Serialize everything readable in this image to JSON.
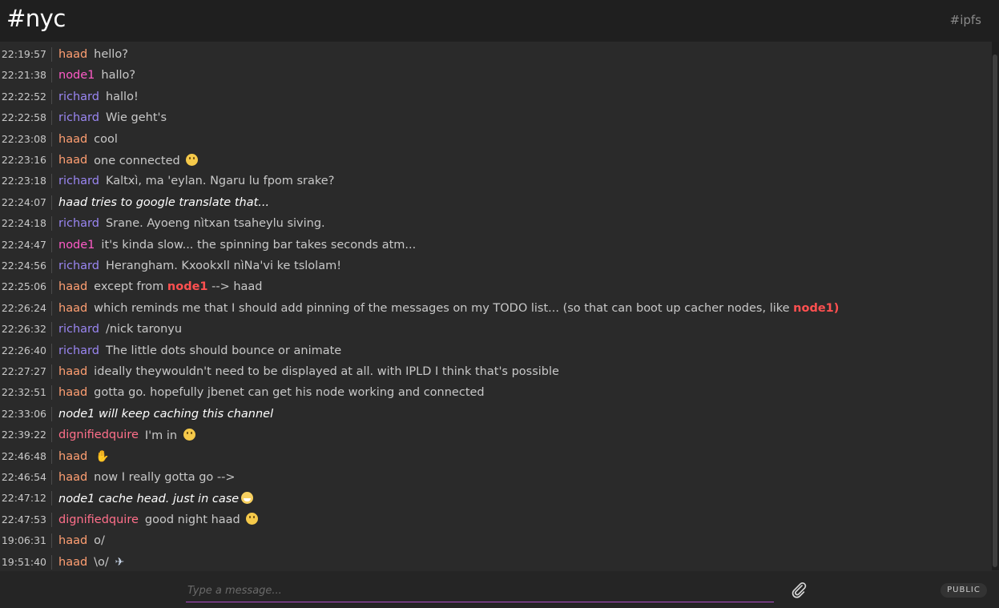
{
  "header": {
    "channel": "#nyc",
    "network_link": "#ipfs"
  },
  "messages": [
    {
      "time": "22:19:57",
      "nick": "haad",
      "type": "msg",
      "parts": [
        {
          "t": "hello?"
        }
      ]
    },
    {
      "time": "22:21:38",
      "nick": "node1",
      "type": "msg",
      "parts": [
        {
          "t": "hallo?"
        }
      ]
    },
    {
      "time": "22:22:52",
      "nick": "richard",
      "type": "msg",
      "parts": [
        {
          "t": "hallo!"
        }
      ]
    },
    {
      "time": "22:22:58",
      "nick": "richard",
      "type": "msg",
      "parts": [
        {
          "t": "Wie geht's"
        }
      ]
    },
    {
      "time": "22:23:08",
      "nick": "haad",
      "type": "msg",
      "parts": [
        {
          "t": "cool"
        }
      ]
    },
    {
      "time": "22:23:16",
      "nick": "haad",
      "type": "msg",
      "parts": [
        {
          "t": "one connected "
        }
      ],
      "emoji": "smile"
    },
    {
      "time": "22:23:18",
      "nick": "richard",
      "type": "msg",
      "parts": [
        {
          "t": "Kaltxì, ma 'eylan. Ngaru lu fpom srake?"
        }
      ]
    },
    {
      "time": "22:24:07",
      "nick": "haad",
      "type": "action",
      "parts": [
        {
          "t": "haad tries to google translate that..."
        }
      ]
    },
    {
      "time": "22:24:18",
      "nick": "richard",
      "type": "msg",
      "parts": [
        {
          "t": "Srane. Ayoeng nìtxan tsaheylu siving."
        }
      ]
    },
    {
      "time": "22:24:47",
      "nick": "node1",
      "type": "msg",
      "parts": [
        {
          "t": "it's kinda slow... the spinning bar takes seconds atm..."
        }
      ]
    },
    {
      "time": "22:24:56",
      "nick": "richard",
      "type": "msg",
      "parts": [
        {
          "t": "Herangham. Kxookxll nìNa'vi ke tslolam!"
        }
      ]
    },
    {
      "time": "22:25:06",
      "nick": "haad",
      "type": "msg",
      "parts": [
        {
          "t": "except from "
        },
        {
          "t": "node1",
          "m": true
        },
        {
          "t": " --> haad"
        }
      ]
    },
    {
      "time": "22:26:24",
      "nick": "haad",
      "type": "msg",
      "parts": [
        {
          "t": "which reminds me that I should add pinning of the messages on my TODO list... (so that can boot up cacher nodes, like "
        },
        {
          "t": "node1)",
          "m": true
        }
      ]
    },
    {
      "time": "22:26:32",
      "nick": "richard",
      "type": "msg",
      "parts": [
        {
          "t": "/nick taronyu"
        }
      ]
    },
    {
      "time": "22:26:40",
      "nick": "richard",
      "type": "msg",
      "parts": [
        {
          "t": "The little dots should bounce or animate"
        }
      ]
    },
    {
      "time": "22:27:27",
      "nick": "haad",
      "type": "msg",
      "parts": [
        {
          "t": "ideally theywouldn't need to be displayed at all. with IPLD I think that's possible"
        }
      ]
    },
    {
      "time": "22:32:51",
      "nick": "haad",
      "type": "msg",
      "parts": [
        {
          "t": "gotta go. hopefully jbenet can get his node working and connected"
        }
      ]
    },
    {
      "time": "22:33:06",
      "nick": "node1",
      "type": "action",
      "parts": [
        {
          "t": "node1 will keep caching this channel"
        }
      ]
    },
    {
      "time": "22:39:22",
      "nick": "dignifiedquire",
      "type": "msg",
      "parts": [
        {
          "t": "I'm in "
        }
      ],
      "emoji": "smile"
    },
    {
      "time": "22:46:48",
      "nick": "haad",
      "type": "msg",
      "parts": [
        {
          "t": ""
        }
      ],
      "emoji": "wave"
    },
    {
      "time": "22:46:54",
      "nick": "haad",
      "type": "msg",
      "parts": [
        {
          "t": "now I really gotta go -->"
        }
      ]
    },
    {
      "time": "22:47:12",
      "nick": "node1",
      "type": "action",
      "parts": [
        {
          "t": "node1 cache head. just in case"
        }
      ],
      "emoji": "grin"
    },
    {
      "time": "22:47:53",
      "nick": "dignifiedquire",
      "type": "msg",
      "parts": [
        {
          "t": "good night haad "
        }
      ],
      "emoji": "smile"
    },
    {
      "time": "19:06:31",
      "nick": "haad",
      "type": "msg",
      "parts": [
        {
          "t": "o/"
        }
      ]
    },
    {
      "time": "19:51:40",
      "nick": "haad",
      "type": "msg",
      "parts": [
        {
          "t": "\\o/ "
        }
      ],
      "emoji": "rocket"
    }
  ],
  "composer": {
    "placeholder": "Type a message...",
    "visibility": "PUBLIC"
  },
  "colors": {
    "haad": "#ff9f72",
    "node1": "#ff5bc8",
    "richard": "#9a86f2",
    "dignifiedquire": "#ff6f8a",
    "mention": "#ff5050",
    "input_underline": "#b04cc8"
  }
}
